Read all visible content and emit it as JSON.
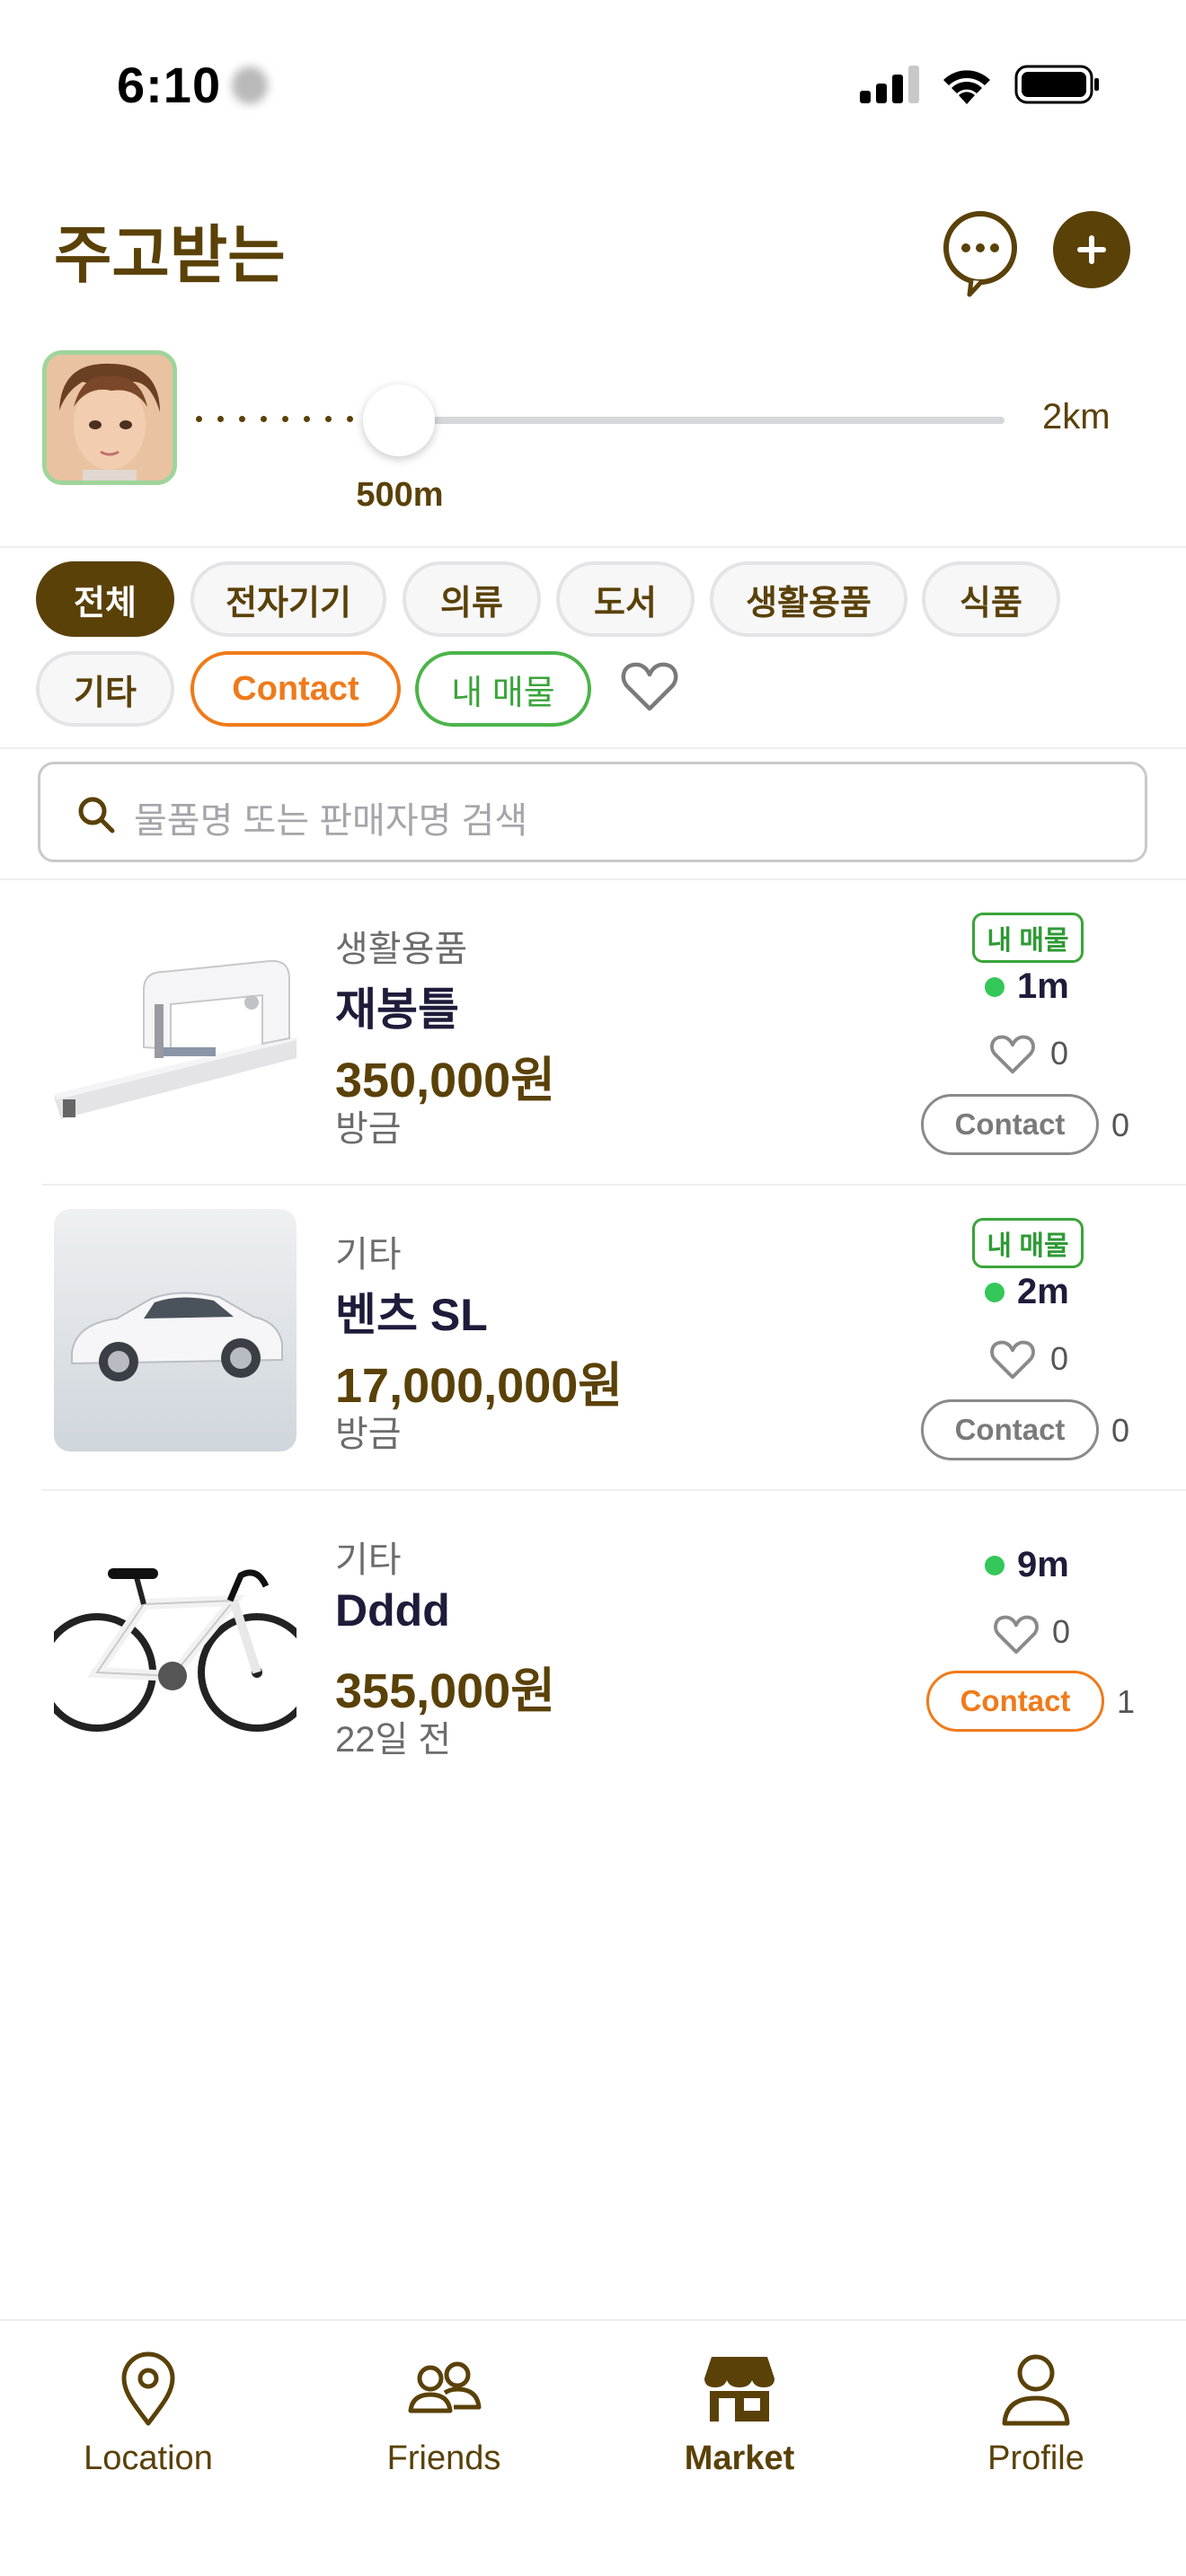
{
  "status_bar": {
    "time": "6:10"
  },
  "header": {
    "title": "주고받는"
  },
  "distance_filter": {
    "selected": "500m",
    "max": "2km"
  },
  "categories": [
    {
      "label": "전체",
      "active": true
    },
    {
      "label": "전자기기"
    },
    {
      "label": "의류"
    },
    {
      "label": "도서"
    },
    {
      "label": "생활용품"
    },
    {
      "label": "식품"
    },
    {
      "label": "기타"
    }
  ],
  "filters": {
    "contact": "Contact",
    "mine": "내 매물"
  },
  "search": {
    "placeholder": "물품명 또는 판매자명 검색"
  },
  "listings": [
    {
      "category": "생활용품",
      "title": "재봉틀",
      "price": "350,000원",
      "time": "방금",
      "mine_badge": "내 매물",
      "distance": "1m",
      "likes": "0",
      "contact_label": "Contact",
      "contact_count": "0"
    },
    {
      "category": "기타",
      "title": "벤츠 SL",
      "price": "17,000,000원",
      "time": "방금",
      "mine_badge": "내 매물",
      "distance": "2m",
      "likes": "0",
      "contact_label": "Contact",
      "contact_count": "0"
    },
    {
      "category": "기타",
      "title": "Dddd",
      "price": "355,000원",
      "time": "22일 전",
      "distance": "9m",
      "likes": "0",
      "contact_label": "Contact",
      "contact_count": "1"
    }
  ],
  "tabs": [
    {
      "label": "Location",
      "icon": "location-pin-icon"
    },
    {
      "label": "Friends",
      "icon": "friends-icon"
    },
    {
      "label": "Market",
      "icon": "store-icon",
      "active": true
    },
    {
      "label": "Profile",
      "icon": "profile-icon"
    }
  ],
  "colors": {
    "brand": "#5a4108",
    "accent_orange": "#f07a1a",
    "accent_green": "#3aa43a",
    "online_dot": "#34c759"
  }
}
